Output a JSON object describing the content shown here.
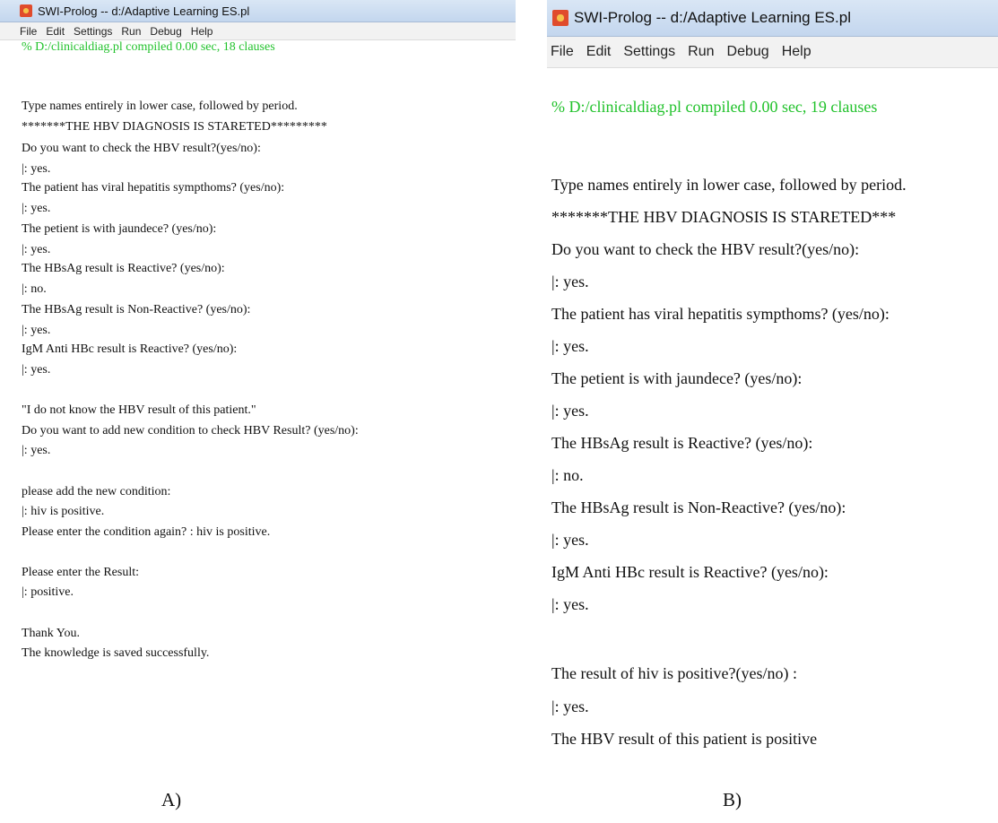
{
  "panel_a": {
    "window_title": "SWI-Prolog -- d:/Adaptive Learning ES.pl",
    "menu": [
      "File",
      "Edit",
      "Settings",
      "Run",
      "Debug",
      "Help"
    ],
    "compile_line": "% D:/clinicaldiag.pl compiled 0.00 sec, 18 clauses",
    "lines": [
      "Type names entirely in lower case, followed by period.",
      "*******THE HBV DIAGNOSIS IS STARETED*********",
      "Do you want to check the HBV result?(yes/no):",
      "|: yes.",
      "The patient has viral hepatitis sympthoms? (yes/no):",
      "|: yes.",
      "The petient is with jaundece? (yes/no):",
      "|: yes.",
      "The HBsAg result is Reactive? (yes/no):",
      "|: no.",
      "The HBsAg result is Non-Reactive? (yes/no):",
      "|: yes.",
      "IgM Anti HBc result is Reactive? (yes/no):",
      "|: yes.",
      "\"I do not know the HBV result of this patient.\"",
      "Do you want to add new condition to check HBV Result? (yes/no):",
      "|: yes.",
      "please add the new condition:",
      "|: hiv is positive.",
      "Please enter the condition again? : hiv is positive.",
      "Please enter the Result:",
      "|: positive.",
      "Thank You.",
      "The knowledge is saved successfully."
    ]
  },
  "panel_b": {
    "window_title": "SWI-Prolog -- d:/Adaptive Learning ES.pl",
    "menu": [
      "File",
      "Edit",
      "Settings",
      "Run",
      "Debug",
      "Help"
    ],
    "compile_line": "% D:/clinicaldiag.pl compiled 0.00 sec, 19 clauses",
    "lines": [
      "Type names entirely in lower case, followed by period.",
      "*******THE HBV DIAGNOSIS IS STARETED***",
      "Do you want to check the HBV result?(yes/no):",
      "|: yes.",
      "The patient has viral hepatitis sympthoms? (yes/no):",
      "|: yes.",
      "The petient is with jaundece? (yes/no):",
      "|: yes.",
      "The HBsAg result is Reactive? (yes/no):",
      "|: no.",
      "The HBsAg result is Non-Reactive? (yes/no):",
      "|: yes.",
      "IgM Anti HBc result is Reactive? (yes/no):",
      "|: yes.",
      "The result of hiv is positive?(yes/no) :",
      "|: yes.",
      "The HBV result of this patient is positive"
    ]
  },
  "captions": {
    "a": "A)",
    "b": "B)"
  },
  "colors": {
    "compile_text": "#22c22c",
    "title_bar": "#c9daf0",
    "menu_bar": "#f2f2f2"
  },
  "icons": {
    "window": "swi-prolog-app-icon"
  }
}
